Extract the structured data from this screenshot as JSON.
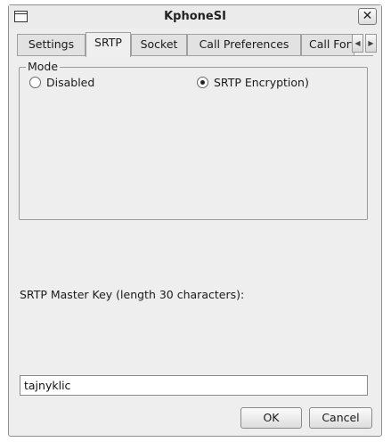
{
  "window": {
    "title": "KphoneSI",
    "close_label": "✕"
  },
  "tabs": [
    {
      "label": "Settings",
      "active": false
    },
    {
      "label": "SRTP",
      "active": true
    },
    {
      "label": "Socket",
      "active": false
    },
    {
      "label": "Call Preferences",
      "active": false
    },
    {
      "label": "Call Forv",
      "active": false
    }
  ],
  "tab_scroll": {
    "left": "◀",
    "right": "▶"
  },
  "mode": {
    "title": "Mode",
    "options": [
      {
        "label": "Disabled",
        "checked": false
      },
      {
        "label": "SRTP Encryption)",
        "checked": true
      }
    ]
  },
  "master_key": {
    "label": "SRTP Master Key (length 30 characters):",
    "value": "tajnyklic"
  },
  "buttons": {
    "ok": "OK",
    "cancel": "Cancel"
  }
}
